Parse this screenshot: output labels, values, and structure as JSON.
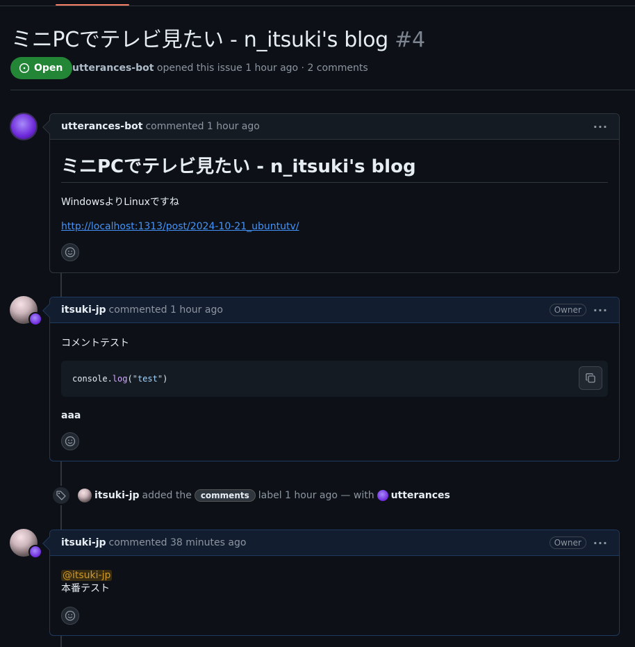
{
  "issue": {
    "title": "ミニPCでテレビ見たい - n_itsuki's blog",
    "number": "#4",
    "state": "Open",
    "author": "utterances-bot",
    "meta_text": "opened this issue 1 hour ago · 2 comments"
  },
  "comments": [
    {
      "author": "utterances-bot",
      "time_text": "commented 1 hour ago",
      "heading": "ミニPCでテレビ見たい - n_itsuki's blog",
      "paragraph": "WindowsよりLinuxですね",
      "link": "http://localhost:1313/post/2024-10-21_ubuntutv/"
    },
    {
      "author": "itsuki-jp",
      "time_text": "commented 1 hour ago",
      "role": "Owner",
      "paragraph": "コメントテスト",
      "code": {
        "obj": "console.",
        "fn": "log",
        "open": "(",
        "str": "\"test\"",
        "close": ")"
      },
      "bold": "aaa"
    },
    {
      "author": "itsuki-jp",
      "time_text": "commented 38 minutes ago",
      "role": "Owner",
      "mention": "@itsuki-jp",
      "paragraph": "本番テスト"
    }
  ],
  "event": {
    "actor": "itsuki-jp",
    "pre_text": "added the",
    "label": "comments",
    "post_text": "label 1 hour ago — with",
    "app": "utterances"
  },
  "icons": [
    "issue-opened-icon",
    "smiley-icon",
    "copy-icon",
    "tag-icon",
    "kebab-icon"
  ],
  "colors": {
    "open_badge": "#238636",
    "link": "#4493f8",
    "mention": "#d29922",
    "background": "#0d1117"
  }
}
